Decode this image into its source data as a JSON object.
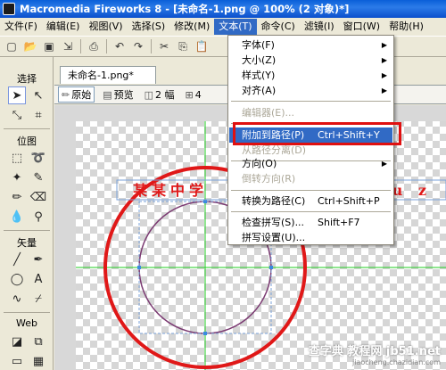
{
  "window": {
    "title": "Macromedia Fireworks 8 - [未命名-1.png @ 100% (2 对象)*]"
  },
  "menubar": [
    "文件(F)",
    "编辑(E)",
    "视图(V)",
    "选择(S)",
    "修改(M)",
    "文本(T)",
    "命令(C)",
    "滤镜(I)",
    "窗口(W)",
    "帮助(H)"
  ],
  "tools": {
    "select_label": "选择",
    "bitmap_label": "位图",
    "vector_label": "矢量",
    "web_label": "Web"
  },
  "document": {
    "tab": "未命名-1.png*",
    "views": {
      "original": "原始",
      "preview": "预览",
      "two_up": "2 幅",
      "four_up": "4"
    }
  },
  "canvas": {
    "text_left": "某某中学",
    "text_right": "ou z"
  },
  "text_menu": {
    "font": "字体(F)",
    "size": "大小(Z)",
    "style": "样式(Y)",
    "align": "对齐(A)",
    "editor": "编辑器(E)...",
    "attach_to_path": "附加到路径(P)",
    "attach_shortcut": "Ctrl+Shift+Y",
    "detach_from_path": "从路径分离(D)",
    "direction": "方向(O)",
    "reverse_direction": "倒转方向(R)",
    "convert_to_paths": "转换为路径(C)",
    "convert_shortcut": "Ctrl+Shift+P",
    "check_spelling": "检查拼写(S)...",
    "spelling_shortcut": "Shift+F7",
    "spelling_setup": "拼写设置(U)..."
  },
  "watermark": {
    "line1": "查字典 教程网 jb51.net",
    "line2": "jiaocheng.chazidian.com"
  },
  "colors": {
    "ring": "#e01818",
    "guide": "#22cc22",
    "highlight": "#316ac5",
    "callout": "#e01010"
  }
}
